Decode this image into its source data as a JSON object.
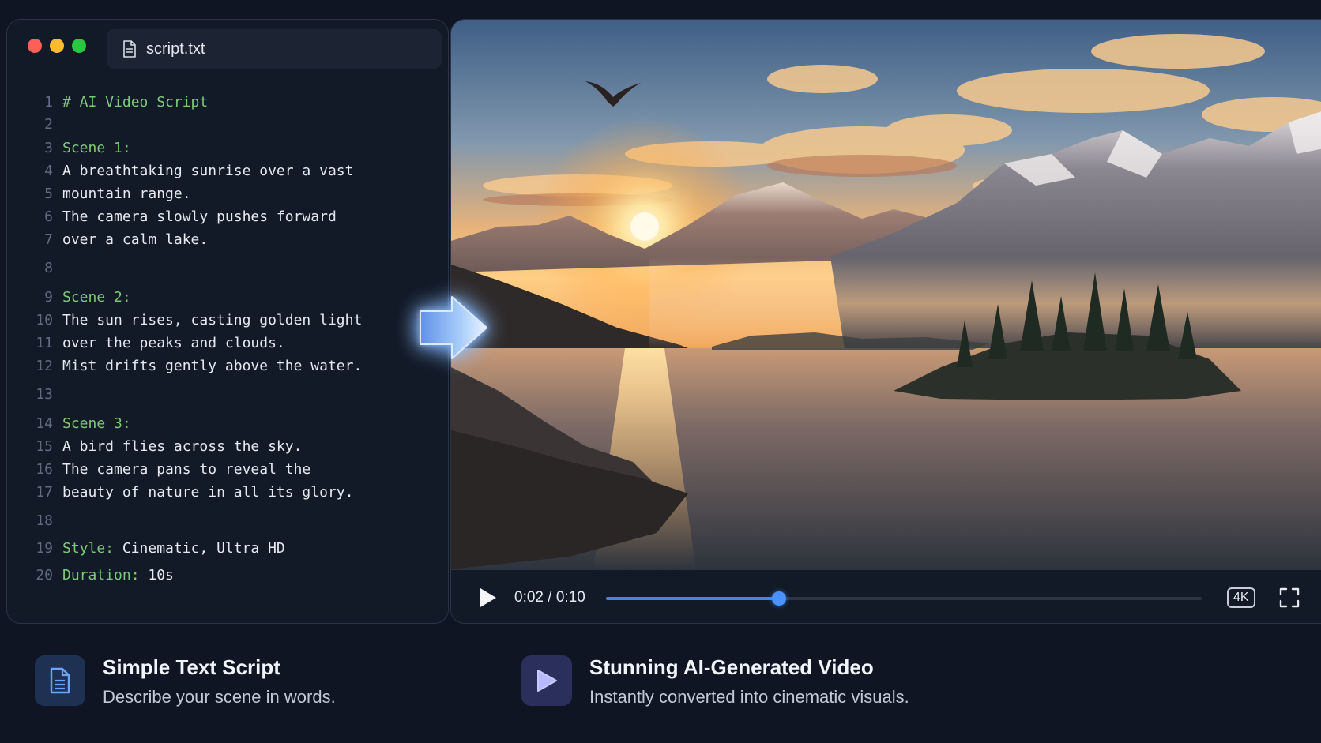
{
  "editor": {
    "filename": "script.txt",
    "lines": [
      {
        "n": "1",
        "parts": [
          {
            "t": "# AI Video Script",
            "c": "hl"
          }
        ]
      },
      {
        "n": "2",
        "parts": []
      },
      {
        "n": "3",
        "parts": [
          {
            "t": "Scene 1:",
            "c": "hl"
          }
        ]
      },
      {
        "n": "4",
        "parts": [
          {
            "t": "A breathtaking sunrise over a vast",
            "c": ""
          }
        ]
      },
      {
        "n": "5",
        "parts": [
          {
            "t": "mountain range.",
            "c": ""
          }
        ]
      },
      {
        "n": "6",
        "parts": [
          {
            "t": "The camera slowly pushes forward",
            "c": ""
          }
        ]
      },
      {
        "n": "7",
        "parts": [
          {
            "t": "over a calm lake.",
            "c": ""
          }
        ]
      },
      {
        "n": "8",
        "parts": []
      },
      {
        "n": "9",
        "parts": [
          {
            "t": "Scene 2:",
            "c": "hl"
          }
        ]
      },
      {
        "n": "10",
        "parts": [
          {
            "t": "The sun rises, casting golden light",
            "c": ""
          }
        ]
      },
      {
        "n": "11",
        "parts": [
          {
            "t": "over the peaks and clouds.",
            "c": ""
          }
        ]
      },
      {
        "n": "12",
        "parts": [
          {
            "t": "Mist drifts gently above the water.",
            "c": ""
          }
        ]
      },
      {
        "n": "13",
        "parts": []
      },
      {
        "n": "14",
        "parts": [
          {
            "t": "Scene 3:",
            "c": "hl"
          }
        ]
      },
      {
        "n": "15",
        "parts": [
          {
            "t": "A bird flies across the sky.",
            "c": ""
          }
        ]
      },
      {
        "n": "16",
        "parts": [
          {
            "t": "The camera pans to reveal the",
            "c": ""
          }
        ]
      },
      {
        "n": "17",
        "parts": [
          {
            "t": "beauty of nature in all its glory.",
            "c": ""
          }
        ]
      },
      {
        "n": "18",
        "parts": []
      },
      {
        "n": "19",
        "parts": [
          {
            "t": "Style:",
            "c": "hl"
          },
          {
            "t": " Cinematic, Ultra HD",
            "c": ""
          }
        ]
      },
      {
        "n": "20",
        "parts": [
          {
            "t": "Duration:",
            "c": "hl"
          },
          {
            "t": " 10s",
            "c": ""
          }
        ]
      }
    ]
  },
  "player": {
    "time": "0:02 / 0:10",
    "progress": 0.29,
    "quality": "4K"
  },
  "features": [
    {
      "title": "Simple Text Script",
      "desc": "Describe your scene in words.",
      "icon": "document-icon"
    },
    {
      "title": "Stunning AI-Generated Video",
      "desc": "Instantly converted into cinematic visuals.",
      "icon": "play-icon"
    }
  ],
  "colors": {
    "background": "#0f1522",
    "keyword_green": "#7ec87a",
    "accent_blue": "#3c86f0"
  }
}
